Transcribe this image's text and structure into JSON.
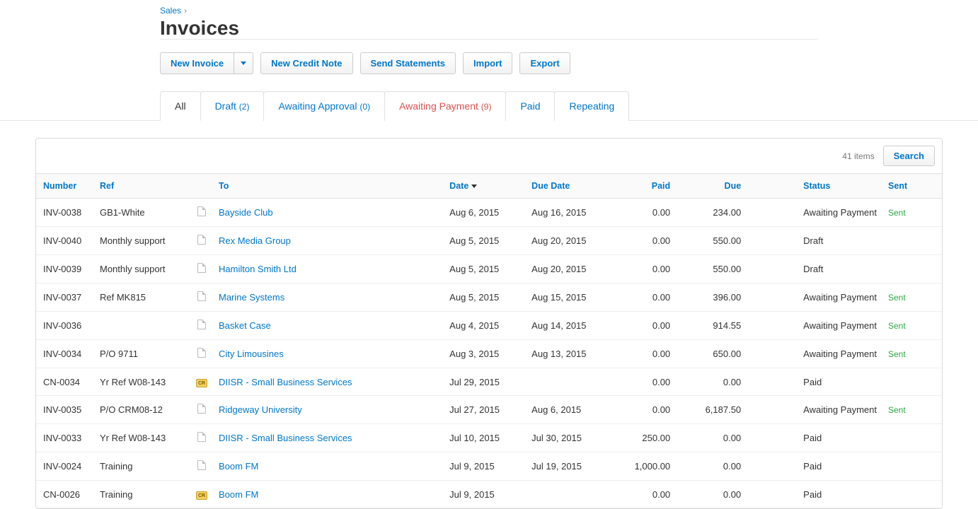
{
  "breadcrumb": {
    "sales": "Sales",
    "sep": "›"
  },
  "page_title": "Invoices",
  "actions": {
    "new_invoice": "New Invoice",
    "new_credit_note": "New Credit Note",
    "send_statements": "Send Statements",
    "import": "Import",
    "export": "Export"
  },
  "tabs": {
    "all": "All",
    "draft": {
      "label": "Draft",
      "count": "(2)"
    },
    "awaiting_approval": {
      "label": "Awaiting Approval",
      "count": "(0)"
    },
    "awaiting_payment": {
      "label": "Awaiting Payment",
      "count": "(9)"
    },
    "paid": "Paid",
    "repeating": "Repeating"
  },
  "items_count": "41 items",
  "search_label": "Search",
  "columns": {
    "number": "Number",
    "ref": "Ref",
    "to": "To",
    "date": "Date",
    "due_date": "Due Date",
    "paid": "Paid",
    "due": "Due",
    "status": "Status",
    "sent": "Sent"
  },
  "sent_label": "Sent",
  "cr_badge": "CR",
  "rows": [
    {
      "number": "INV-0038",
      "ref": "GB1-White",
      "icon": "doc",
      "to": "Bayside Club",
      "date": "Aug 6, 2015",
      "due_date": "Aug 16, 2015",
      "paid": "0.00",
      "due": "234.00",
      "status": "Awaiting Payment",
      "sent": true
    },
    {
      "number": "INV-0040",
      "ref": "Monthly support",
      "icon": "doc",
      "to": "Rex Media Group",
      "date": "Aug 5, 2015",
      "due_date": "Aug 20, 2015",
      "paid": "0.00",
      "due": "550.00",
      "status": "Draft",
      "sent": false
    },
    {
      "number": "INV-0039",
      "ref": "Monthly support",
      "icon": "doc",
      "to": "Hamilton Smith Ltd",
      "date": "Aug 5, 2015",
      "due_date": "Aug 20, 2015",
      "paid": "0.00",
      "due": "550.00",
      "status": "Draft",
      "sent": false
    },
    {
      "number": "INV-0037",
      "ref": "Ref MK815",
      "icon": "doc",
      "to": "Marine Systems",
      "date": "Aug 5, 2015",
      "due_date": "Aug 15, 2015",
      "paid": "0.00",
      "due": "396.00",
      "status": "Awaiting Payment",
      "sent": true
    },
    {
      "number": "INV-0036",
      "ref": "",
      "icon": "doc",
      "to": "Basket Case",
      "date": "Aug 4, 2015",
      "due_date": "Aug 14, 2015",
      "paid": "0.00",
      "due": "914.55",
      "status": "Awaiting Payment",
      "sent": true
    },
    {
      "number": "INV-0034",
      "ref": "P/O 9711",
      "icon": "doc",
      "to": "City Limousines",
      "date": "Aug 3, 2015",
      "due_date": "Aug 13, 2015",
      "paid": "0.00",
      "due": "650.00",
      "status": "Awaiting Payment",
      "sent": true
    },
    {
      "number": "CN-0034",
      "ref": "Yr Ref W08-143",
      "icon": "cr",
      "to": "DIISR - Small Business Services",
      "date": "Jul 29, 2015",
      "due_date": "",
      "paid": "0.00",
      "due": "0.00",
      "status": "Paid",
      "sent": false
    },
    {
      "number": "INV-0035",
      "ref": "P/O CRM08-12",
      "icon": "doc",
      "to": "Ridgeway University",
      "date": "Jul 27, 2015",
      "due_date": "Aug 6, 2015",
      "paid": "0.00",
      "due": "6,187.50",
      "status": "Awaiting Payment",
      "sent": true
    },
    {
      "number": "INV-0033",
      "ref": "Yr Ref W08-143",
      "icon": "doc",
      "to": "DIISR - Small Business Services",
      "date": "Jul 10, 2015",
      "due_date": "Jul 30, 2015",
      "paid": "250.00",
      "due": "0.00",
      "status": "Paid",
      "sent": false
    },
    {
      "number": "INV-0024",
      "ref": "Training",
      "icon": "doc",
      "to": "Boom FM",
      "date": "Jul 9, 2015",
      "due_date": "Jul 19, 2015",
      "paid": "1,000.00",
      "due": "0.00",
      "status": "Paid",
      "sent": false
    },
    {
      "number": "CN-0026",
      "ref": "Training",
      "icon": "cr",
      "to": "Boom FM",
      "date": "Jul 9, 2015",
      "due_date": "",
      "paid": "0.00",
      "due": "0.00",
      "status": "Paid",
      "sent": false
    }
  ]
}
